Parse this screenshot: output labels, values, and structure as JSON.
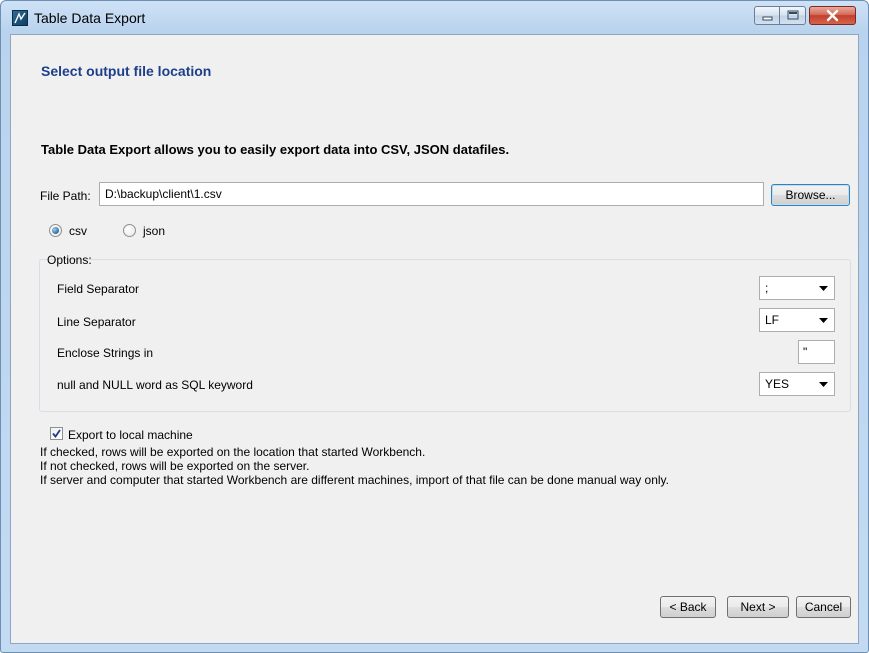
{
  "window": {
    "title": "Table Data Export"
  },
  "page": {
    "heading": "Select output file location",
    "intro": "Table Data Export allows you to easily export data into CSV, JSON datafiles."
  },
  "file_path": {
    "label": "File Path:",
    "value": "D:\\backup\\client\\1.csv",
    "browse_label": "Browse..."
  },
  "format": {
    "options": [
      {
        "label": "csv",
        "selected": true
      },
      {
        "label": "json",
        "selected": false
      }
    ]
  },
  "options": {
    "legend": "Options:",
    "field_separator": {
      "label": "Field Separator",
      "value": ";"
    },
    "line_separator": {
      "label": "Line Separator",
      "value": "LF"
    },
    "enclose_strings": {
      "label": "Enclose Strings in",
      "value": "\""
    },
    "null_keyword": {
      "label": "null and NULL word as SQL keyword",
      "value": "YES"
    }
  },
  "export_local": {
    "label": "Export to local machine",
    "checked": true,
    "notes": [
      "If checked, rows will be exported on the location that started Workbench.",
      "If not checked, rows will be exported on the server.",
      "If server and computer that started Workbench are different machines, import of that file can be done manual way only."
    ]
  },
  "nav": {
    "back_label": "< Back",
    "next_label": "Next >",
    "cancel_label": "Cancel"
  }
}
